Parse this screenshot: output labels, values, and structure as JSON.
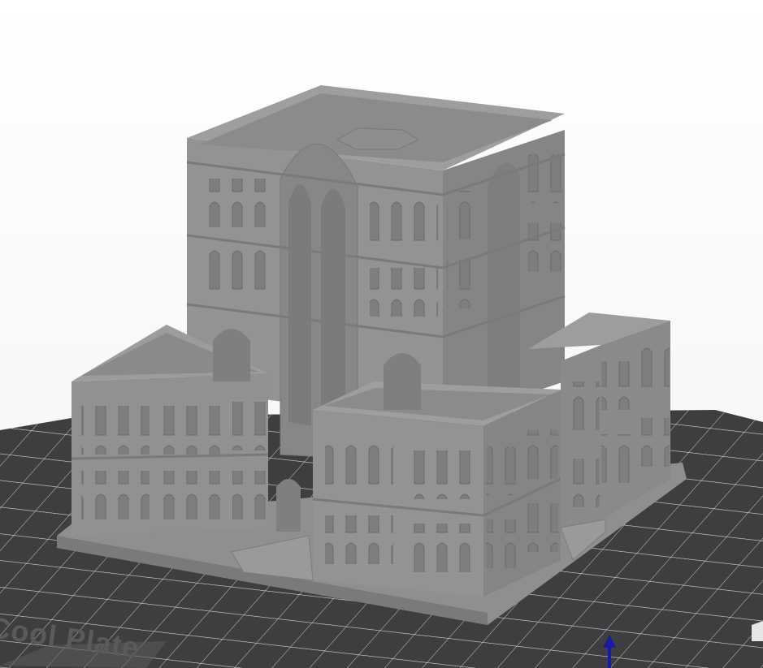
{
  "viewport": {
    "plate_label": "Cool Plate"
  },
  "colors": {
    "background": "#ffffff",
    "plate": "#3e3e40",
    "grid": "#cfcfcf",
    "model_light": "#979797",
    "model_mid": "#8a8a8a",
    "model_dark": "#767676",
    "axis_z": "#1a1aa8"
  },
  "icons": {
    "z_axis": "arrow-up-icon"
  }
}
